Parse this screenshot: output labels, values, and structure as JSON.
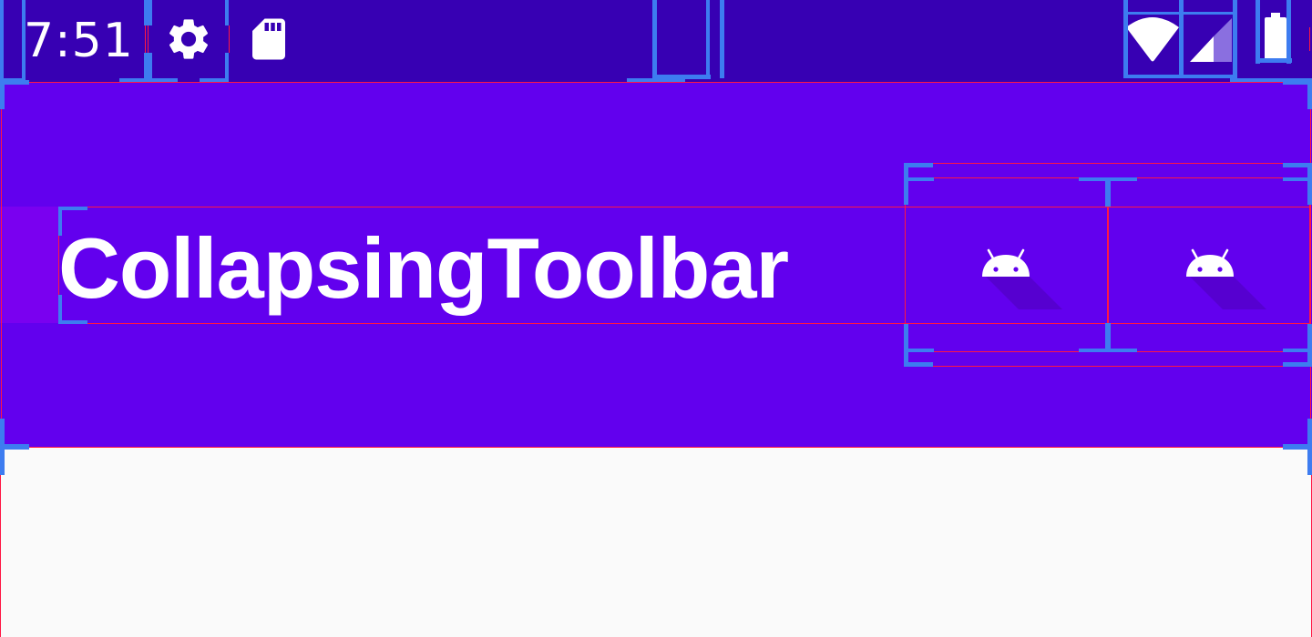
{
  "status_bar": {
    "time": "7:51",
    "background_color": "#3700b3",
    "icons": [
      "settings-icon",
      "sd-card-icon",
      "wifi-icon",
      "cell-signal-icon",
      "battery-icon"
    ]
  },
  "toolbar": {
    "title": "CollapsingToolbar",
    "background_color": "#6200ee",
    "actions": [
      {
        "icon": "android-icon"
      },
      {
        "icon": "android-icon"
      }
    ]
  },
  "content": {
    "background_color": "#fafafa"
  },
  "debug_overlay": {
    "bounds_color": "#ff1744",
    "corner_color": "#3d7cf0"
  }
}
